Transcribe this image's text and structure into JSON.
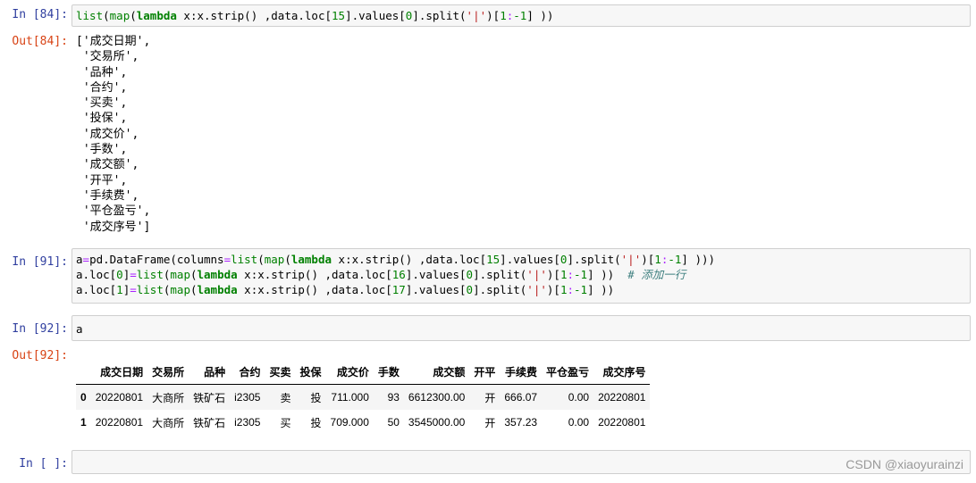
{
  "cells": [
    {
      "in_prompt": "In  [84]:",
      "out_prompt": "Out[84]:",
      "output_lines": [
        "['成交日期',",
        " '交易所',",
        " '品种',",
        " '合约',",
        " '买卖',",
        " '投保',",
        " '成交价',",
        " '手数',",
        " '成交额',",
        " '开平',",
        " '手续费',",
        " '平仓盈亏',",
        " '成交序号']"
      ]
    },
    {
      "in_prompt": "In  [91]:"
    },
    {
      "in_prompt": "In  [92]:",
      "code": "a",
      "out_prompt": "Out[92]:"
    },
    {
      "in_prompt": "In  [ ]:"
    }
  ],
  "code_tokens": {
    "c84": [
      "list",
      "(",
      "map",
      "(",
      "lambda",
      " x:x.strip() ,data.loc[",
      "15",
      "].values[",
      "0",
      "].split(",
      "'|'",
      ")[",
      "1",
      ":",
      "-1",
      "] ))"
    ],
    "c91_l1": [
      "a",
      "=",
      "pd.DataFrame(columns",
      "=",
      "list",
      "(",
      "map",
      "(",
      "lambda",
      " x:x.strip() ,data.loc[",
      "15",
      "].values[",
      "0",
      "].split(",
      "'|'",
      ")[",
      "1",
      ":",
      "-1",
      "] )))"
    ],
    "c91_l2": [
      "a.loc[",
      "0",
      "]",
      "=",
      "list",
      "(",
      "map",
      "(",
      "lambda",
      " x:x.strip() ,data.loc[",
      "16",
      "].values[",
      "0",
      "].split(",
      "'|'",
      ")[",
      "1",
      ":",
      "-1",
      "] ))  ",
      "# 添加一行"
    ],
    "c91_l3": [
      "a.loc[",
      "1",
      "]",
      "=",
      "list",
      "(",
      "map",
      "(",
      "lambda",
      " x:x.strip() ,data.loc[",
      "17",
      "].values[",
      "0",
      "].split(",
      "'|'",
      ")[",
      "1",
      ":",
      "-1",
      "] ))"
    ]
  },
  "dataframe": {
    "columns": [
      "成交日期",
      "交易所",
      "品种",
      "合约",
      "买卖",
      "投保",
      "成交价",
      "手数",
      "成交额",
      "开平",
      "手续费",
      "平仓盈亏",
      "成交序号"
    ],
    "rows": [
      {
        "index": "0",
        "values": [
          "20220801",
          "大商所",
          "铁矿石",
          "i2305",
          "卖",
          "投",
          "711.000",
          "93",
          "6612300.00",
          "开",
          "666.07",
          "0.00",
          "20220801"
        ]
      },
      {
        "index": "1",
        "values": [
          "20220801",
          "大商所",
          "铁矿石",
          "i2305",
          "买",
          "投",
          "709.000",
          "50",
          "3545000.00",
          "开",
          "357.23",
          "0.00",
          "20220801"
        ]
      }
    ]
  },
  "watermark": "CSDN @xiaoyurainzi",
  "colors": {
    "in_prompt": "#303f9f",
    "out_prompt": "#d84315",
    "keyword": "#008000",
    "string": "#ba2121",
    "comment": "#408080"
  }
}
